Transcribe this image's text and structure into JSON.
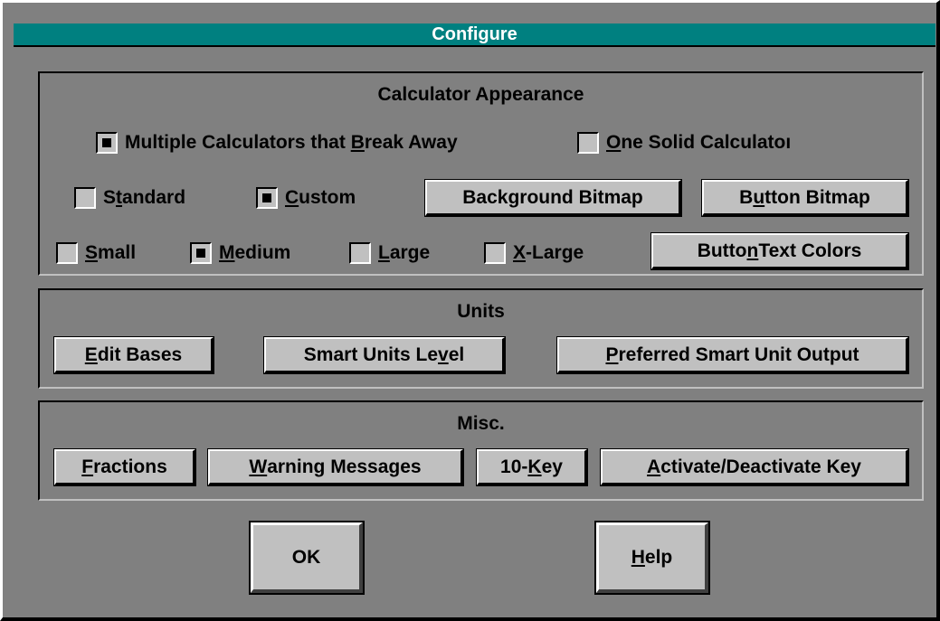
{
  "window": {
    "title": "Configure"
  },
  "appearance": {
    "title": "Calculator Appearance",
    "multiple": {
      "pre": "Multiple Calculators that ",
      "u": "B",
      "post": "reak Away",
      "checked": true
    },
    "solid": {
      "pre": "",
      "u": "O",
      "post": "ne Solid Calculatoı",
      "checked": false
    },
    "standard": {
      "pre": "S",
      "u": "t",
      "post": "andard",
      "checked": false
    },
    "custom": {
      "pre": "",
      "u": "C",
      "post": "ustom",
      "checked": true
    },
    "background_bitmap": {
      "pre": "Back",
      "u": "g",
      "post": "round Bitmap"
    },
    "button_bitmap": {
      "pre": "B",
      "u": "u",
      "post": "tton Bitmap"
    },
    "small": {
      "pre": "",
      "u": "S",
      "post": "mall",
      "checked": false
    },
    "medium": {
      "pre": "",
      "u": "M",
      "post": "edium",
      "checked": true
    },
    "large": {
      "pre": "",
      "u": "L",
      "post": "arge",
      "checked": false
    },
    "xlarge": {
      "pre": "",
      "u": "X",
      "post": "-Large",
      "checked": false
    },
    "button_text_colors": {
      "pre": "Butto",
      "u": "n",
      "post": " Text Colors"
    }
  },
  "units": {
    "title": "Units",
    "edit_bases": {
      "pre": "",
      "u": "E",
      "post": "dit Bases"
    },
    "smart_units_level": {
      "pre": "Smart Units Le",
      "u": "v",
      "post": "el"
    },
    "preferred_output": {
      "pre": "",
      "u": "P",
      "post": "referred Smart Unit Output"
    }
  },
  "misc": {
    "title": "Misc.",
    "fractions": {
      "pre": "",
      "u": "F",
      "post": "ractions"
    },
    "warning_messages": {
      "pre": "",
      "u": "W",
      "post": "arning Messages"
    },
    "ten_key": {
      "pre": "10-",
      "u": "K",
      "post": "ey"
    },
    "activate_key": {
      "pre": "",
      "u": "A",
      "post": "ctivate/Deactivate Key"
    }
  },
  "footer": {
    "ok": {
      "pre": "OK",
      "u": "",
      "post": ""
    },
    "help": {
      "pre": "",
      "u": "H",
      "post": "elp"
    }
  },
  "colors": {
    "titlebar": "#008080",
    "dialog": "#808080",
    "button": "#c0c0c0"
  }
}
